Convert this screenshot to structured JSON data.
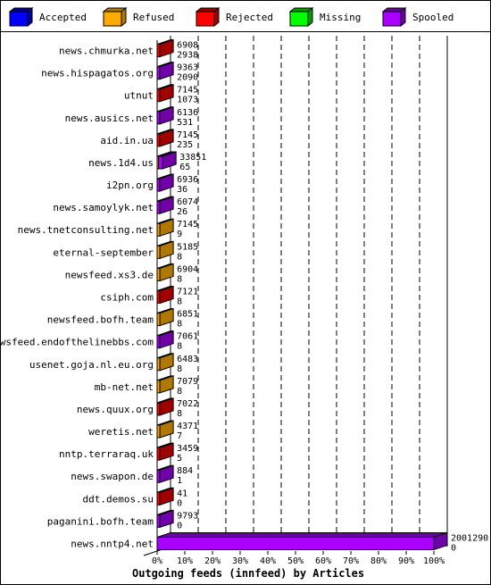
{
  "chart_data": {
    "type": "bar",
    "orientation": "horizontal",
    "stacked": true,
    "style": "3d",
    "title": "Outgoing feeds (innfeed) by Articles",
    "xlabel": "Outgoing feeds (innfeed) by Articles",
    "ylabel": "",
    "xlim": [
      0,
      100
    ],
    "x_unit": "%",
    "x_ticks": [
      "0%",
      "10%",
      "20%",
      "30%",
      "40%",
      "50%",
      "60%",
      "70%",
      "80%",
      "90%",
      "100%"
    ],
    "grid": true,
    "legend_position": "top",
    "legend": [
      {
        "name": "Accepted",
        "color": "#0000ff",
        "side": "#0000a0"
      },
      {
        "name": "Refused",
        "color": "#ffaa00",
        "side": "#b07800"
      },
      {
        "name": "Rejected",
        "color": "#ff0000",
        "side": "#a00000"
      },
      {
        "name": "Missing",
        "color": "#00ff00",
        "side": "#00a000"
      },
      {
        "name": "Spooled",
        "color": "#aa00ff",
        "side": "#7000a8"
      }
    ],
    "categories": [
      "news.chmurka.net",
      "news.hispagatos.org",
      "utnut",
      "news.ausics.net",
      "aid.in.ua",
      "news.1d4.us",
      "i2pn.org",
      "news.samoylyk.net",
      "news.tnetconsulting.net",
      "eternal-september",
      "newsfeed.xs3.de",
      "csiph.com",
      "newsfeed.bofh.team",
      "newsfeed.endofthelinebbs.com",
      "usenet.goja.nl.eu.org",
      "mb-net.net",
      "news.quux.org",
      "weretis.net",
      "nntp.terraraq.uk",
      "news.swapon.de",
      "ddt.demos.su",
      "paganini.bofh.team",
      "news.nntp4.net"
    ],
    "rows": [
      {
        "name": "news.chmurka.net",
        "total": "6908",
        "accepted": "2938",
        "segments": [
          {
            "series": "Rejected",
            "percent": 1
          }
        ]
      },
      {
        "name": "news.hispagatos.org",
        "total": "9363",
        "accepted": "2090",
        "segments": [
          {
            "series": "Spooled",
            "percent": 1
          }
        ]
      },
      {
        "name": "utnut",
        "total": "7145",
        "accepted": "1073",
        "segments": [
          {
            "series": "Rejected",
            "percent": 1
          }
        ]
      },
      {
        "name": "news.ausics.net",
        "total": "6136",
        "accepted": "531",
        "segments": [
          {
            "series": "Spooled",
            "percent": 1
          }
        ]
      },
      {
        "name": "aid.in.ua",
        "total": "7145",
        "accepted": "235",
        "segments": [
          {
            "series": "Rejected",
            "percent": 1
          }
        ]
      },
      {
        "name": "news.1d4.us",
        "total": "33851",
        "accepted": "65",
        "segments": [
          {
            "series": "Refused",
            "percent": 0.5
          },
          {
            "series": "Spooled",
            "percent": 1.5
          }
        ]
      },
      {
        "name": "i2pn.org",
        "total": "6936",
        "accepted": "36",
        "segments": [
          {
            "series": "Spooled",
            "percent": 1
          }
        ]
      },
      {
        "name": "news.samoylyk.net",
        "total": "6074",
        "accepted": "26",
        "segments": [
          {
            "series": "Spooled",
            "percent": 1
          }
        ]
      },
      {
        "name": "news.tnetconsulting.net",
        "total": "7145",
        "accepted": "9",
        "segments": [
          {
            "series": "Refused",
            "percent": 1
          }
        ]
      },
      {
        "name": "eternal-september",
        "total": "5185",
        "accepted": "8",
        "segments": [
          {
            "series": "Refused",
            "percent": 1
          }
        ]
      },
      {
        "name": "newsfeed.xs3.de",
        "total": "6904",
        "accepted": "8",
        "segments": [
          {
            "series": "Refused",
            "percent": 1
          }
        ]
      },
      {
        "name": "csiph.com",
        "total": "7121",
        "accepted": "8",
        "segments": [
          {
            "series": "Rejected",
            "percent": 1
          }
        ]
      },
      {
        "name": "newsfeed.bofh.team",
        "total": "6851",
        "accepted": "8",
        "segments": [
          {
            "series": "Refused",
            "percent": 1
          }
        ]
      },
      {
        "name": "newsfeed.endofthelinebbs.com",
        "total": "7061",
        "accepted": "8",
        "segments": [
          {
            "series": "Spooled",
            "percent": 1
          }
        ]
      },
      {
        "name": "usenet.goja.nl.eu.org",
        "total": "6483",
        "accepted": "8",
        "segments": [
          {
            "series": "Refused",
            "percent": 1
          }
        ]
      },
      {
        "name": "mb-net.net",
        "total": "7079",
        "accepted": "8",
        "segments": [
          {
            "series": "Refused",
            "percent": 1
          }
        ]
      },
      {
        "name": "news.quux.org",
        "total": "7022",
        "accepted": "8",
        "segments": [
          {
            "series": "Rejected",
            "percent": 1
          }
        ]
      },
      {
        "name": "weretis.net",
        "total": "4371",
        "accepted": "7",
        "segments": [
          {
            "series": "Refused",
            "percent": 1
          }
        ]
      },
      {
        "name": "nntp.terraraq.uk",
        "total": "3459",
        "accepted": "5",
        "segments": [
          {
            "series": "Rejected",
            "percent": 1
          }
        ]
      },
      {
        "name": "news.swapon.de",
        "total": "884",
        "accepted": "1",
        "segments": [
          {
            "series": "Spooled",
            "percent": 1
          }
        ]
      },
      {
        "name": "ddt.demos.su",
        "total": "41",
        "accepted": "0",
        "segments": [
          {
            "series": "Rejected",
            "percent": 1
          }
        ]
      },
      {
        "name": "paganini.bofh.team",
        "total": "9793",
        "accepted": "0",
        "segments": [
          {
            "series": "Spooled",
            "percent": 1
          }
        ]
      },
      {
        "name": "news.nntp4.net",
        "total": "2001290",
        "accepted": "0",
        "segments": [
          {
            "series": "Spooled",
            "percent": 100
          }
        ]
      }
    ]
  }
}
